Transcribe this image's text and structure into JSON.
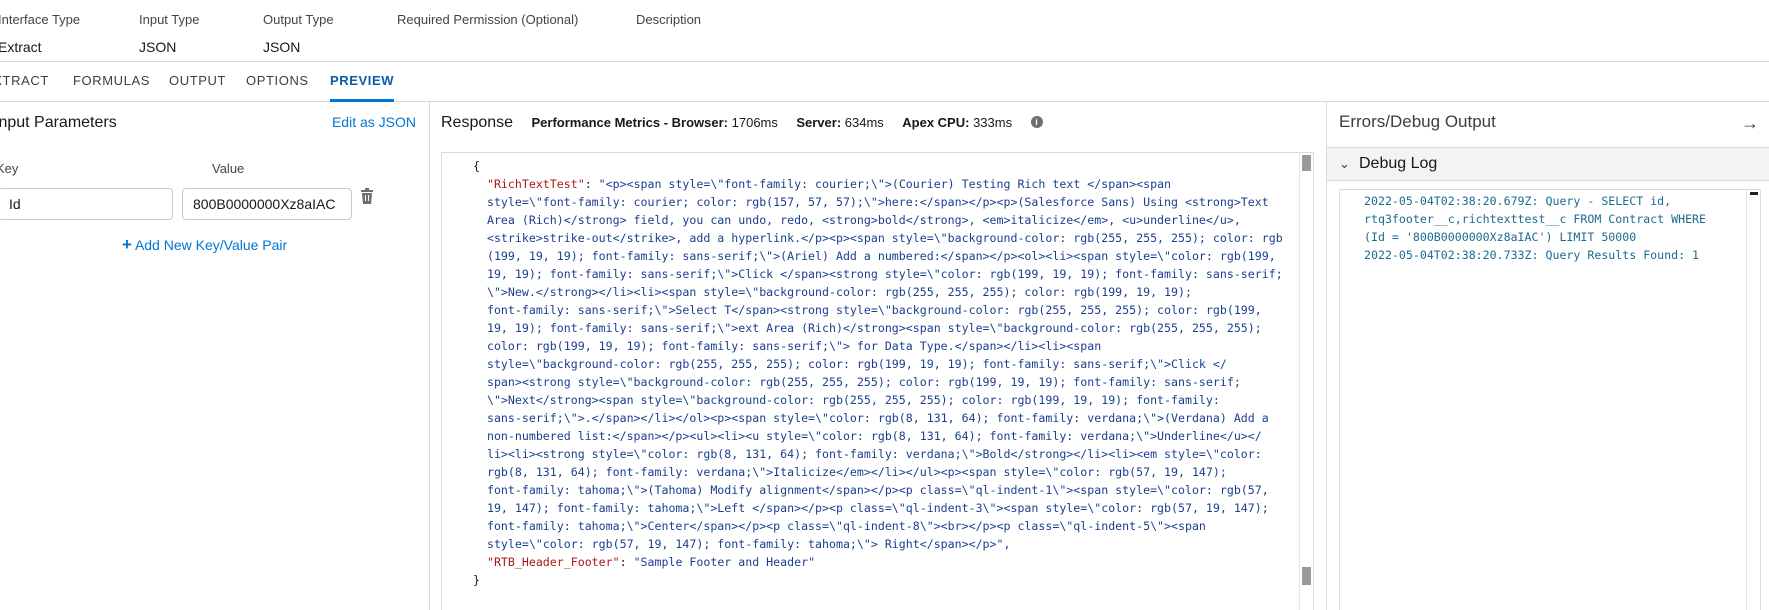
{
  "meta": {
    "interface_type_label": "Interface Type",
    "interface_type_value": "Extract",
    "input_type_label": "Input Type",
    "input_type_value": "JSON",
    "output_type_label": "Output Type",
    "output_type_value": "JSON",
    "permission_label": "Required Permission (Optional)",
    "description_label": "Description"
  },
  "tabs": [
    "EXTRACT",
    "FORMULAS",
    "OUTPUT",
    "OPTIONS",
    "PREVIEW"
  ],
  "active_tab": "PREVIEW",
  "input_params": {
    "title": "Input Parameters",
    "edit_json": "Edit as JSON",
    "key_header": "Key",
    "value_header": "Value",
    "row": {
      "key": "Id",
      "value": "800B0000000Xz8aIAC"
    },
    "add_pair": "Add New Key/Value Pair"
  },
  "response": {
    "title": "Response",
    "browser_label": "Performance Metrics - Browser:",
    "browser_value": "1706ms",
    "server_label": "Server:",
    "server_value": "634ms",
    "apex_label": "Apex CPU:",
    "apex_value": "333ms",
    "open_brace": "{",
    "key1": "\"RichTextTest\"",
    "key2": "\"RTB_Header_Footer\"",
    "value2": "\"Sample Footer and Header\"",
    "close_brace": "}",
    "value1_lines": [
      "\"<p><span style=\\\"font-family: courier;\\\">(Courier) Testing Rich text </span><span",
      "style=\\\"font-family: courier; color: rgb(157, 57, 57);\\\">here:</span></p><p>(Salesforce Sans) Using <strong>Text",
      "Area (Rich)</strong> field, you can undo, redo, <strong>bold</strong>, <em>italicize</em>, <u>underline</u>,",
      "<strike>strike-out</strike>, add a hyperlink.</p><p><span style=\\\"background-color: rgb(255, 255, 255); color: rgb",
      "(199, 19, 19); font-family: sans-serif;\\\">(Ariel) Add a numbered:</span></p><ol><li><span style=\\\"color: rgb(199,",
      "19, 19); font-family: sans-serif;\\\">Click </span><strong style=\\\"color: rgb(199, 19, 19); font-family: sans-serif;",
      "\\\">New.</strong></li><li><span style=\\\"background-color: rgb(255, 255, 255); color: rgb(199, 19, 19);",
      "font-family: sans-serif;\\\">Select T</span><strong style=\\\"background-color: rgb(255, 255, 255); color: rgb(199,",
      "19, 19); font-family: sans-serif;\\\">ext Area (Rich)</strong><span style=\\\"background-color: rgb(255, 255, 255);",
      "color: rgb(199, 19, 19); font-family: sans-serif;\\\"> for Data Type.</span></li><li><span",
      "style=\\\"background-color: rgb(255, 255, 255); color: rgb(199, 19, 19); font-family: sans-serif;\\\">Click </",
      "span><strong style=\\\"background-color: rgb(255, 255, 255); color: rgb(199, 19, 19); font-family: sans-serif;",
      "\\\">Next</strong><span style=\\\"background-color: rgb(255, 255, 255); color: rgb(199, 19, 19); font-family:",
      "sans-serif;\\\">.</span></li></ol><p><span style=\\\"color: rgb(8, 131, 64); font-family: verdana;\\\">(Verdana) Add a",
      "non-numbered list:</span></p><ul><li><u style=\\\"color: rgb(8, 131, 64); font-family: verdana;\\\">Underline</u></",
      "li><li><strong style=\\\"color: rgb(8, 131, 64); font-family: verdana;\\\">Bold</strong></li><li><em style=\\\"color:",
      "rgb(8, 131, 64); font-family: verdana;\\\">Italicize</em></li></ul><p><span style=\\\"color: rgb(57, 19, 147);",
      "font-family: tahoma;\\\">(Tahoma) Modify alignment</span></p><p class=\\\"ql-indent-1\\\"><span style=\\\"color: rgb(57,",
      "19, 147); font-family: tahoma;\\\">Left </span></p><p class=\\\"ql-indent-3\\\"><span style=\\\"color: rgb(57, 19, 147);",
      "font-family: tahoma;\\\">Center</span></p><p class=\\\"ql-indent-8\\\"><br></p><p class=\\\"ql-indent-5\\\"><span",
      "style=\\\"color: rgb(57, 19, 147); font-family: tahoma;\\\"> Right</span></p>\","
    ]
  },
  "debug": {
    "title": "Errors/Debug Output",
    "log_title": "Debug Log",
    "lines": [
      "2022-05-04T02:38:20.679Z: Query - SELECT id,",
      "rtq3footer__c,richtexttest__c FROM Contract WHERE",
      "(Id = '800B0000000Xz8aIAC') LIMIT 50000",
      "2022-05-04T02:38:20.733Z: Query Results Found: 1"
    ]
  },
  "colors": {
    "accent": "#0176d3",
    "json_key": "#b01515",
    "json_string": "#1b3f8f",
    "debug_text": "#1b6b8f"
  }
}
